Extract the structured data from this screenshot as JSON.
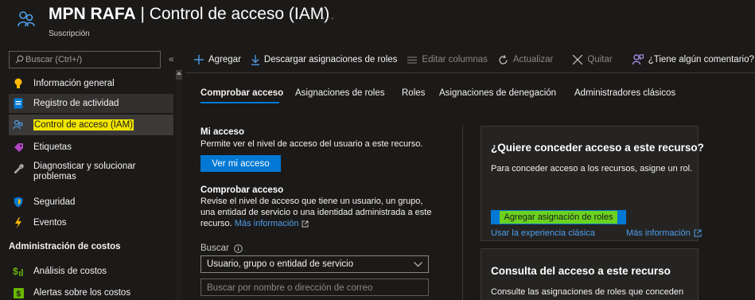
{
  "header": {
    "resource_name": "MPN RAFA",
    "title_separator": " | ",
    "page_title": "Control de acceso (IAM)",
    "subtitle": "Suscripción",
    "more": "···"
  },
  "sidebar": {
    "search_placeholder": "Buscar (Ctrl+/)",
    "collapse": "«",
    "items": [
      {
        "label": "Información general",
        "icon": "lightbulb-icon"
      },
      {
        "label": "Registro de actividad",
        "icon": "activity-log-icon"
      },
      {
        "label": "Control de acceso (IAM)",
        "icon": "people-icon"
      },
      {
        "label": "Etiquetas",
        "icon": "tag-icon"
      },
      {
        "label": "Diagnosticar y solucionar",
        "label2": "problemas",
        "icon": "wrench-icon"
      },
      {
        "label": "Seguridad",
        "icon": "shield-icon"
      },
      {
        "label": "Eventos",
        "icon": "lightning-icon"
      }
    ],
    "cost_section": "Administración de costos",
    "cost_items": [
      {
        "label": "Análisis de costos",
        "icon": "cost-analysis-icon"
      },
      {
        "label": "Alertas sobre los costos",
        "icon": "cost-alert-icon"
      }
    ]
  },
  "toolbar": {
    "add": "Agregar",
    "download": "Descargar asignaciones de roles",
    "edit_columns": "Editar columnas",
    "refresh": "Actualizar",
    "remove": "Quitar",
    "feedback": "¿Tiene algún comentario?"
  },
  "tabs": [
    "Comprobar acceso",
    "Asignaciones de roles",
    "Roles",
    "Asignaciones de denegación",
    "Administradores clásicos"
  ],
  "my_access": {
    "title": "Mi acceso",
    "desc": "Permite ver el nivel de acceso del usuario a este recurso.",
    "button": "Ver mi acceso"
  },
  "check_access": {
    "title": "Comprobar acceso",
    "desc1": "Revise el nivel de acceso que tiene un usuario, un grupo,",
    "desc2": "una entidad de servicio o una identidad administrada a este",
    "desc3": "recurso.",
    "more_info": "Más información",
    "search_label": "Buscar",
    "search_scope": "Usuario, grupo o entidad de servicio",
    "search_placeholder": "Buscar por nombre o dirección de correo"
  },
  "grant_card": {
    "title": "¿Quiere conceder acceso a este recurso?",
    "desc": "Para conceder acceso a los recursos, asigne un rol.",
    "button": "Agregar asignación de roles",
    "classic_link": "Usar la experiencia clásica",
    "more_info": "Más información"
  },
  "view_card": {
    "title": "Consulta del acceso a este recurso",
    "desc": "Consulte las asignaciones de roles que conceden"
  },
  "colors": {
    "accent": "#0078d4",
    "link": "#4f9ee9",
    "highlight_yellow": "#f2e600",
    "highlight_green": "#6bd21f"
  }
}
